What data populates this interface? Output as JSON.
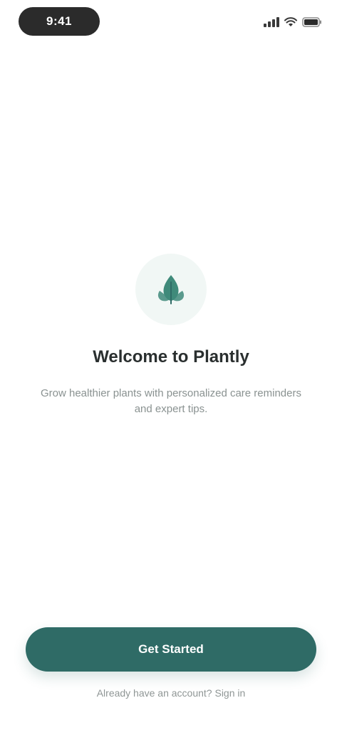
{
  "status_bar": {
    "time": "9:41",
    "icons": [
      "signal-icon",
      "wifi-icon",
      "battery-icon"
    ]
  },
  "hero": {
    "icon": "leaf-icon",
    "title": "Welcome to Plantly",
    "description": "Grow healthier plants with personalized care reminders and expert tips."
  },
  "actions": {
    "primary_label": "Get Started",
    "secondary_label": "Already have an account? Sign in"
  },
  "colors": {
    "accent": "#2f6b66",
    "icon_bg": "#f1f7f5",
    "text_muted": "#8a9291"
  }
}
